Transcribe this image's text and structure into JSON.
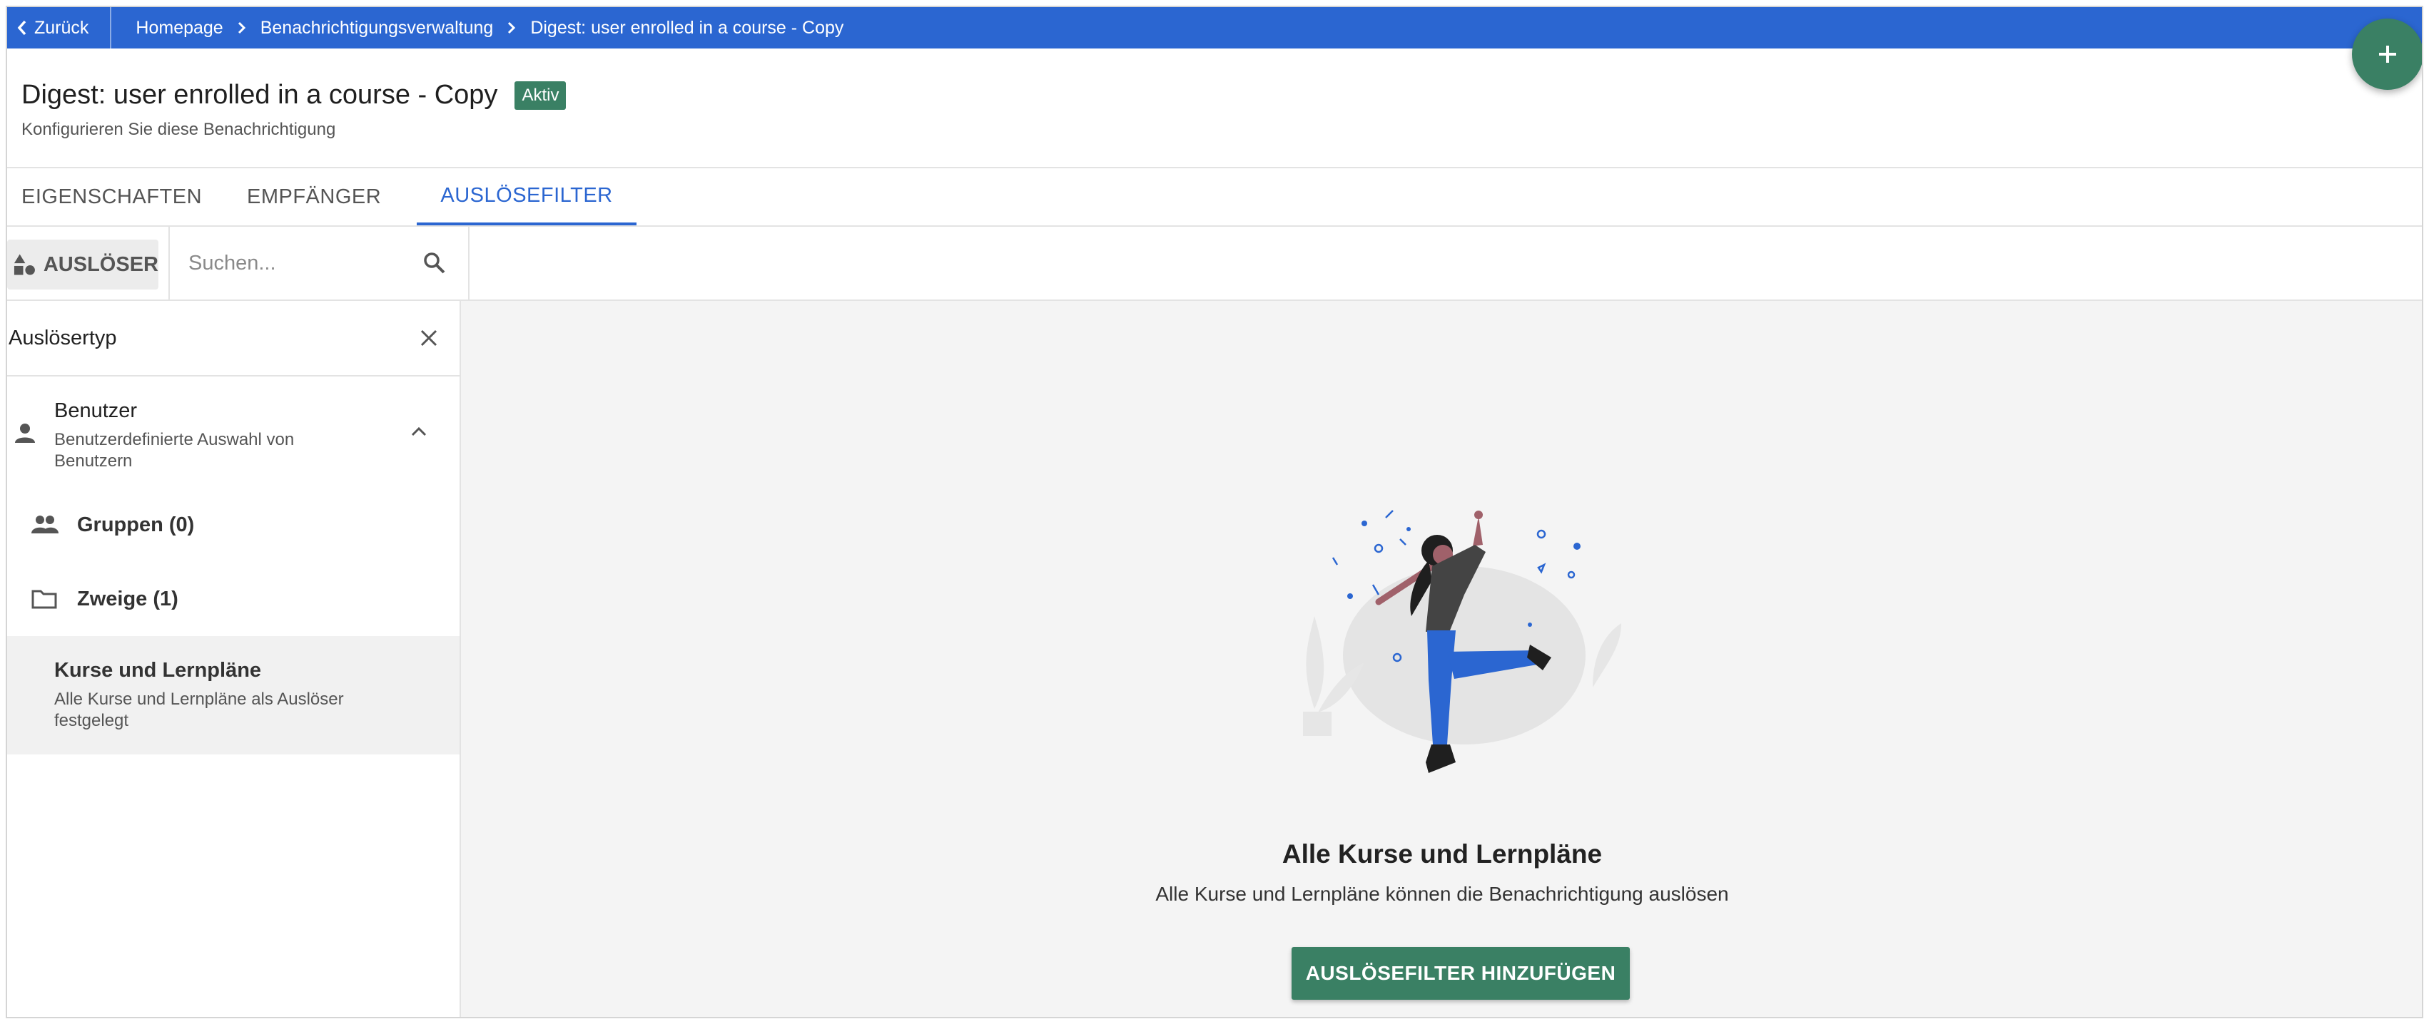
{
  "topbar": {
    "back_label": "Zurück",
    "breadcrumbs": [
      "Homepage",
      "Benachrichtigungsverwaltung",
      "Digest: user enrolled in a course - Copy"
    ]
  },
  "header": {
    "title": "Digest: user enrolled in a course - Copy",
    "status_badge": "Aktiv",
    "subtitle": "Konfigurieren Sie diese Benachrichtigung"
  },
  "tabs": [
    {
      "label": "EIGENSCHAFTEN"
    },
    {
      "label": "EMPFÄNGER"
    },
    {
      "label": "AUSLÖSEFILTER",
      "active": true
    }
  ],
  "toolbar": {
    "trigger_label": "AUSLÖSER",
    "search_placeholder": "Suchen..."
  },
  "sidebar": {
    "heading": "Auslösertyp",
    "user_item": {
      "title": "Benutzer",
      "description": "Benutzerdefinierte Auswahl von Benutzern"
    },
    "groups_label": "Gruppen (0)",
    "branches_label": "Zweige (1)",
    "course_item": {
      "title": "Kurse und Lernpläne",
      "description": "Alle Kurse und Lernpläne als Auslöser festgelegt"
    }
  },
  "main": {
    "empty_title": "Alle Kurse und Lernpläne",
    "empty_description": "Alle Kurse und Lernpläne können die Benachrichtigung auslösen",
    "add_button": "AUSLÖSEFILTER HINZUFÜGEN"
  },
  "icons": [
    "chevron-left-icon",
    "chevron-right-icon",
    "plus-icon",
    "shapes-icon",
    "search-icon",
    "close-icon",
    "person-icon",
    "chevron-up-icon",
    "group-icon",
    "folder-icon"
  ],
  "colors": {
    "primary_blue": "#2b66d1",
    "accent_green": "#3a8064"
  }
}
